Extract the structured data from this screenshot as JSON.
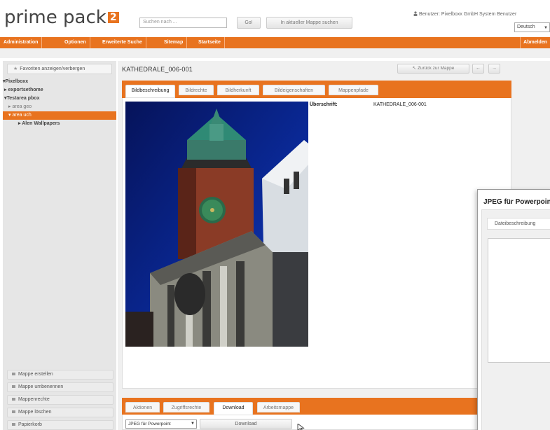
{
  "header": {
    "logo_text": "prime pack",
    "logo_badge": "2",
    "search_placeholder": "Suchen nach ...",
    "go_label": "Go!",
    "folder_search_label": "In aktueller Mappe suchen",
    "user_info": "Benutzer: Pixelboxx GmbH System Benutzer",
    "language": "Deutsch"
  },
  "nav": {
    "items": [
      "Administration",
      "Optionen",
      "Erweiterte Suche",
      "Sitemap",
      "Startseite"
    ],
    "logout": "Abmelden"
  },
  "sidebar": {
    "favorites_label": "Favoriten anzeigen/verbergen",
    "tree": [
      "Pixelboxx",
      "exportsethome",
      "Testarea pbox",
      "area geo",
      "area uch",
      "Alen Wallpapers"
    ],
    "buttons": [
      "Mappe erstellen",
      "Mappe umbenennen",
      "Mappenrechte",
      "Mappe löschen",
      "Papierkorb"
    ]
  },
  "main": {
    "title": "KATHEDRALE_006-001",
    "back_label": "Zurück zur Mappe",
    "prev_icon": "arrow-left-icon",
    "next_icon": "arrow-right-icon",
    "tabs": [
      "Bildbeschreibung",
      "Bildrechte",
      "Bildherkunft",
      "Bildeigenschaften",
      "Mappenpfade"
    ],
    "caption_label": "Überschrift:",
    "caption_value": "KATHEDRALE_006-001",
    "bottom_tabs": [
      "Aktionen",
      "Zugriffsrechte",
      "Download",
      "Arbeitsmappe"
    ],
    "format_value": "JPEG für Powerpoint",
    "download_label": "Download"
  },
  "popup": {
    "title": "JPEG für Powerpoint",
    "tab_label": "Dateibeschreibung"
  },
  "colors": {
    "accent": "#e8731f",
    "sky": "#0a1a66"
  }
}
